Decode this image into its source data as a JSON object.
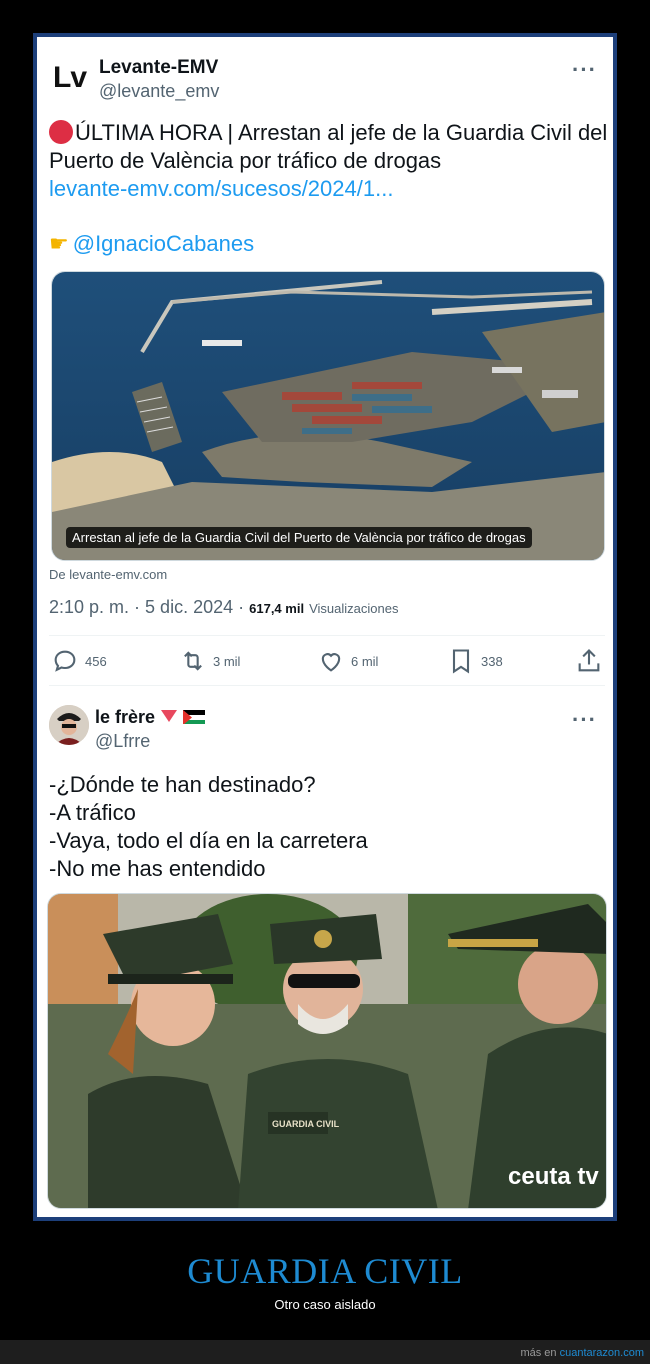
{
  "tweet1": {
    "logo_text": "Lv",
    "name": "Levante-EMV",
    "handle": "@levante_emv",
    "more": "···",
    "text": "ÚLTIMA HORA | Arrestan al jefe de la Guardia Civil del Puerto de València por tráfico de drogas",
    "link": "levante-emv.com/sucesos/2024/1...",
    "mention": "@IgnacioCabanes",
    "media_caption": "Arrestan al jefe de la Guardia Civil del Puerto de València por tráfico de drogas",
    "source": "De levante-emv.com",
    "time": "2:10 p. m.",
    "date": "5 dic. 2024",
    "views": "617,4 mil",
    "views_label": "Visualizaciones",
    "actions": {
      "replies": "456",
      "retweets": "3 mil",
      "likes": "6 mil",
      "bookmarks": "338"
    }
  },
  "tweet2": {
    "name": "le frère",
    "handle": "@Lfrre",
    "more": "···",
    "lines": [
      "-¿Dónde te han destinado?",
      "-A tráfico",
      "-Vaya, todo el día en la carretera",
      "-No me has entendido"
    ],
    "patch_text": "GUARDIA CIVIL",
    "watermark": "ceuta tv"
  },
  "footer": {
    "title": "GUARDIA CIVIL",
    "subtitle": "Otro caso aislado",
    "credit_prefix": "más en",
    "credit_link": "cuantarazon.com"
  },
  "colors": {
    "accent": "#1e8bd2",
    "link": "#1d9bf0",
    "frame": "#1d3f7a"
  }
}
